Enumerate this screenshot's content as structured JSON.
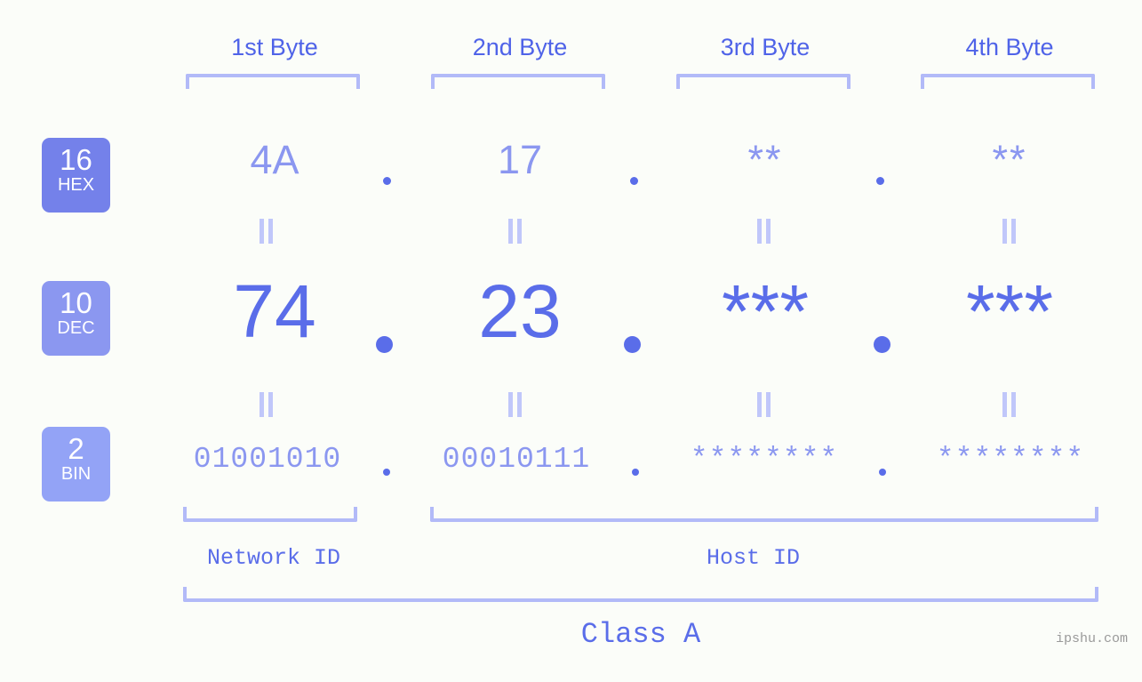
{
  "meta": {
    "background_color": "#fbfdf9",
    "accent_strong": "#5a6de9",
    "accent_mid": "#8b97f0",
    "accent_light": "#b2baf8",
    "watermark_color": "#9a9a9a"
  },
  "headers": [
    {
      "label": "1st Byte"
    },
    {
      "label": "2nd Byte"
    },
    {
      "label": "3rd Byte"
    },
    {
      "label": "4th Byte"
    }
  ],
  "bases": [
    {
      "number": "16",
      "abbr": "HEX",
      "color": "#7481ea"
    },
    {
      "number": "10",
      "abbr": "DEC",
      "color": "#8b97f0"
    },
    {
      "number": "2",
      "abbr": "BIN",
      "color": "#93a3f6"
    }
  ],
  "rows": {
    "hex": {
      "values": [
        "4A",
        "17",
        "**",
        "**"
      ]
    },
    "dec": {
      "values": [
        "74",
        "23",
        "***",
        "***"
      ]
    },
    "bin": {
      "values": [
        "01001010",
        "00010111",
        "********",
        "********"
      ]
    }
  },
  "separators": {
    "hex": ".",
    "dec": ".",
    "bin": "."
  },
  "equivalence_symbol": "=",
  "sections": [
    {
      "label": "Network ID"
    },
    {
      "label": "Host ID"
    }
  ],
  "class": {
    "label": "Class A"
  },
  "watermark": {
    "text": "ipshu.com"
  }
}
